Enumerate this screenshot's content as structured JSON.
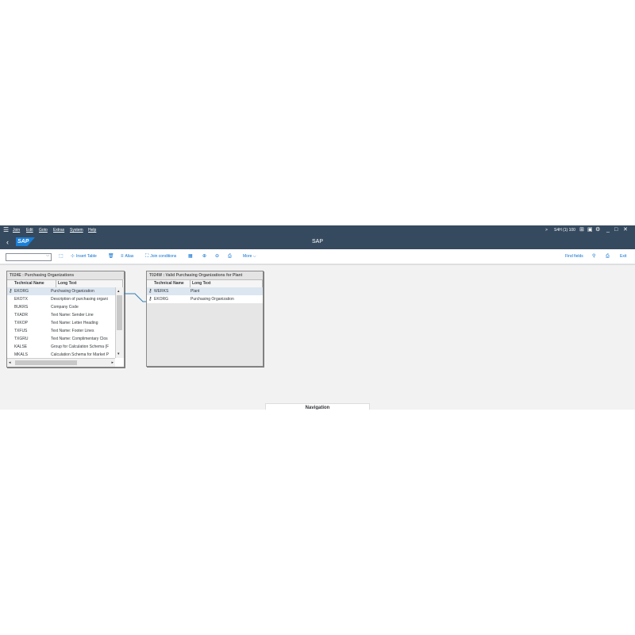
{
  "menubar": {
    "items": [
      "Join",
      "Edit",
      "Goto",
      "Extras",
      "System",
      "Help"
    ],
    "system_info": "S4H (1) 100"
  },
  "titlebar": {
    "logo_text": "SAP",
    "title": "SAP"
  },
  "toolbar": {
    "insert_table": "Insert Table",
    "alias": "Alias",
    "join_conditions": "Join conditions",
    "more": "More",
    "find_fields": "Find fields",
    "exit": "Exit"
  },
  "table_left": {
    "title": "T024E : Purchasing Organizations",
    "columns": [
      "Technical Name",
      "Long Text"
    ],
    "rows": [
      {
        "key": true,
        "name": "EKORG",
        "text": "Purchasing Organization"
      },
      {
        "key": false,
        "name": "EKOTX",
        "text": "Description of purchasing organi"
      },
      {
        "key": false,
        "name": "BUKRS",
        "text": "Company Code"
      },
      {
        "key": false,
        "name": "TXADR",
        "text": "Text Name: Sender Line"
      },
      {
        "key": false,
        "name": "TXKOP",
        "text": "Text Name: Letter Heading"
      },
      {
        "key": false,
        "name": "TXFUS",
        "text": "Text Name: Footer Lines"
      },
      {
        "key": false,
        "name": "TXGRU",
        "text": "Text Name: Complimentary Clos"
      },
      {
        "key": false,
        "name": "KALSE",
        "text": "Group for Calculation Schema (F"
      },
      {
        "key": false,
        "name": "MKALS",
        "text": "Calculation Schema for Market P"
      }
    ]
  },
  "table_right": {
    "title": "T024W : Valid Purchasing Organizations for Plant",
    "columns": [
      "Technical Name",
      "Long Text"
    ],
    "rows": [
      {
        "key": true,
        "name": "WERKS",
        "text": "Plant"
      },
      {
        "key": true,
        "name": "EKORG",
        "text": "Purchasing Organization"
      }
    ]
  },
  "navigation_label": "Navigation",
  "colors": {
    "shell": "#354a5f",
    "accent": "#0a6ed1",
    "logo": "#1a7fd9"
  }
}
